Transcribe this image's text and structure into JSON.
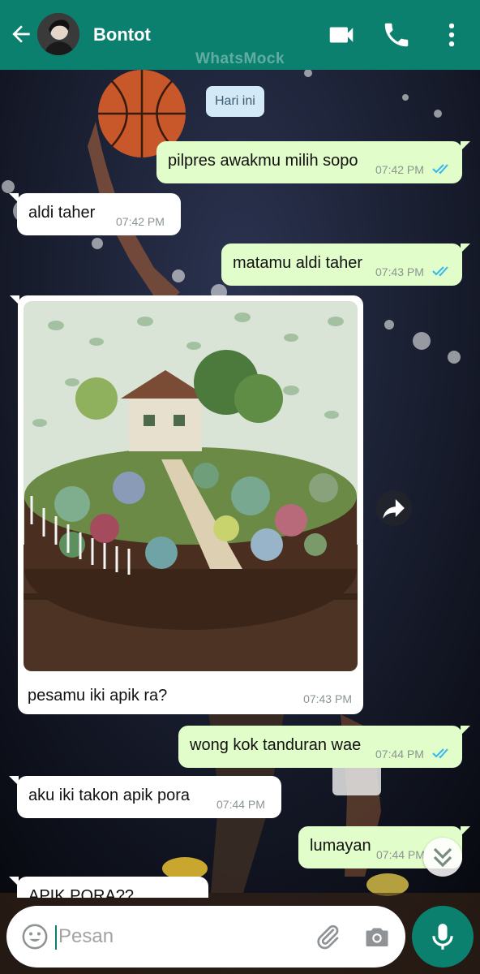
{
  "header": {
    "contact_name": "Bontot",
    "watermark": "WhatsMock",
    "icons": [
      "back-arrow-icon",
      "video-call-icon",
      "phone-icon",
      "more-vert-icon"
    ]
  },
  "date_chip": "Hari ini",
  "messages": [
    {
      "dir": "out",
      "text": "pilpres awakmu milih sopo",
      "time": "07:42 PM",
      "status": "read"
    },
    {
      "dir": "in",
      "text": "aldi taher",
      "time": "07:42 PM"
    },
    {
      "dir": "out",
      "text": "matamu aldi taher",
      "time": "07:43 PM",
      "status": "read"
    },
    {
      "dir": "in",
      "type": "image",
      "caption": "pesamu iki apik ra?",
      "time": "07:43 PM",
      "image": "succulent-fairy-garden-photo"
    },
    {
      "dir": "out",
      "text": "wong kok tanduran wae",
      "time": "07:44 PM",
      "status": "read"
    },
    {
      "dir": "in",
      "text": "aku iki takon apik pora",
      "time": "07:44 PM"
    },
    {
      "dir": "out",
      "text": "lumayan",
      "time": "07:44 PM",
      "status": "read"
    },
    {
      "dir": "in",
      "text": "APIK PORA??"
    }
  ],
  "composer": {
    "placeholder": "Pesan",
    "value": "",
    "icons": [
      "emoji-icon",
      "attach-icon",
      "camera-icon",
      "mic-icon"
    ]
  },
  "colors": {
    "header": "#0b806e",
    "outgoing_bubble": "#e1fdc9",
    "incoming_bubble": "#ffffff",
    "read_ticks": "#34b7f1",
    "date_chip": "#d4e9f7"
  }
}
